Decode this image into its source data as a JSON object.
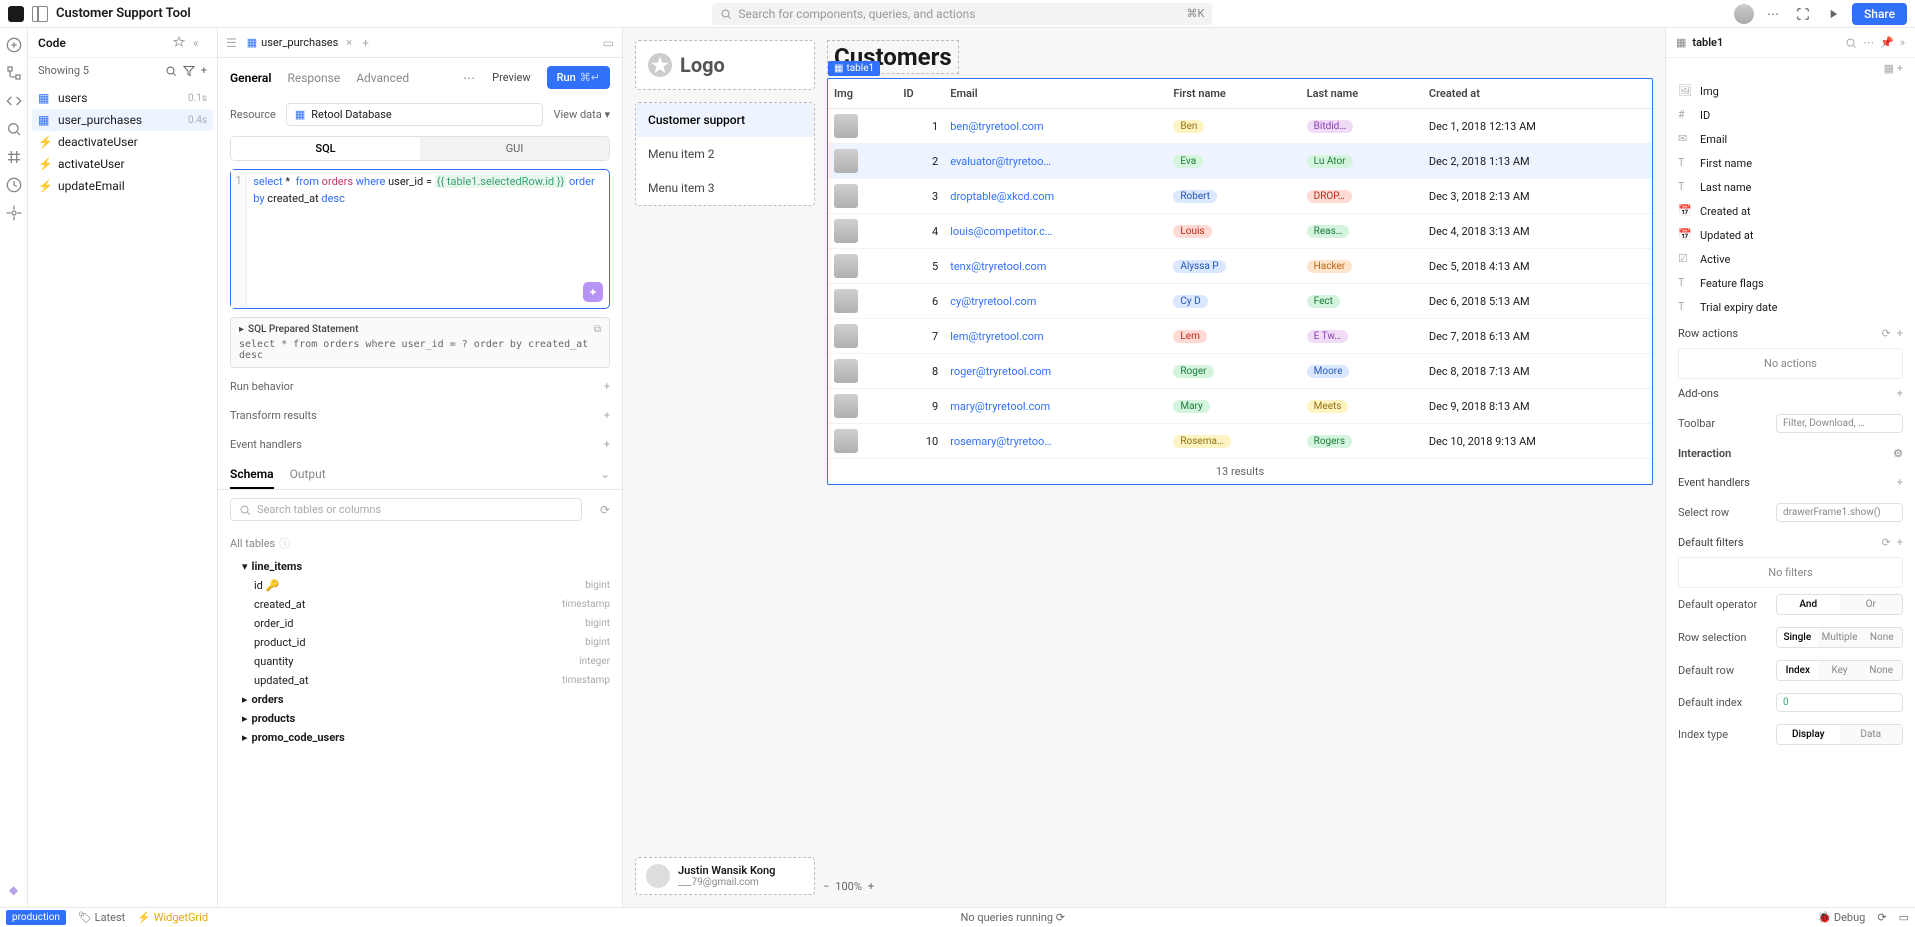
{
  "app_title": "Customer Support Tool",
  "search_placeholder": "Search for components, queries, and actions",
  "search_kbd": "⌘K",
  "share_label": "Share",
  "code_panel": {
    "title": "Code",
    "showing": "Showing 5",
    "items": [
      {
        "name": "users",
        "time": "0.1s",
        "icon": "db"
      },
      {
        "name": "user_purchases",
        "time": "0.4s",
        "icon": "db",
        "selected": true
      },
      {
        "name": "deactivateUser",
        "icon": "fn"
      },
      {
        "name": "activateUser",
        "icon": "fn"
      },
      {
        "name": "updateEmail",
        "icon": "fn"
      }
    ]
  },
  "editor": {
    "tab_name": "user_purchases",
    "sub_tabs": [
      "General",
      "Response",
      "Advanced"
    ],
    "preview": "Preview",
    "run": "Run",
    "run_kbd": "⌘↵",
    "resource_label": "Resource",
    "resource_value": "Retool Database",
    "view_data": "View data",
    "sql_label": "SQL",
    "gui_label": "GUI",
    "sql_line": "1",
    "prep_title": "SQL Prepared Statement",
    "prep_code": "select *  from orders where user_id = ? order by created_at desc",
    "run_behavior": "Run behavior",
    "transform": "Transform results",
    "handlers": "Event handlers",
    "schema_tab": "Schema",
    "output_tab": "Output",
    "schema_search": "Search tables or columns",
    "all_tables": "All tables",
    "schema": {
      "line_items": {
        "open": true,
        "cols": [
          {
            "n": "id",
            "t": "bigint",
            "pk": true
          },
          {
            "n": "created_at",
            "t": "timestamp"
          },
          {
            "n": "order_id",
            "t": "bigint"
          },
          {
            "n": "product_id",
            "t": "bigint"
          },
          {
            "n": "quantity",
            "t": "integer"
          },
          {
            "n": "updated_at",
            "t": "timestamp"
          }
        ]
      },
      "others": [
        "orders",
        "products",
        "promo_code_users"
      ]
    }
  },
  "canvas": {
    "logo": "Logo",
    "menu": [
      "Customer support",
      "Menu item 2",
      "Menu item 3"
    ],
    "customers_title": "Customers",
    "table_badge": "table1",
    "cols": [
      "Img",
      "ID",
      "Email",
      "First name",
      "Last name",
      "Created at"
    ],
    "rows": [
      {
        "id": 1,
        "email": "ben@tryretool.com",
        "fn": "Ben",
        "fnc": "y",
        "ln": "Bitdid…",
        "lnc": "p",
        "ca": "Dec 1, 2018 12:13 AM"
      },
      {
        "id": 2,
        "email": "evaluator@tryretoo…",
        "fn": "Eva",
        "fnc": "g",
        "ln": "Lu Ator",
        "lnc": "g",
        "ca": "Dec 2, 2018 1:13 AM",
        "sel": true
      },
      {
        "id": 3,
        "email": "droptable@xkcd.com",
        "fn": "Robert",
        "fnc": "b",
        "ln": "DROP…",
        "lnc": "r",
        "ca": "Dec 3, 2018 2:13 AM"
      },
      {
        "id": 4,
        "email": "louis@competitor.c…",
        "fn": "Louis",
        "fnc": "r",
        "ln": "Reas…",
        "lnc": "g",
        "ca": "Dec 4, 2018 3:13 AM"
      },
      {
        "id": 5,
        "email": "tenx@tryretool.com",
        "fn": "Alyssa P",
        "fnc": "b",
        "ln": "Hacker",
        "lnc": "o",
        "ca": "Dec 5, 2018 4:13 AM"
      },
      {
        "id": 6,
        "email": "cy@tryretool.com",
        "fn": "Cy D",
        "fnc": "b",
        "ln": "Fect",
        "lnc": "g",
        "ca": "Dec 6, 2018 5:13 AM"
      },
      {
        "id": 7,
        "email": "lem@tryretool.com",
        "fn": "Lem",
        "fnc": "r",
        "ln": "E Tw…",
        "lnc": "p",
        "ca": "Dec 7, 2018 6:13 AM"
      },
      {
        "id": 8,
        "email": "roger@tryretool.com",
        "fn": "Roger",
        "fnc": "g",
        "ln": "Moore",
        "lnc": "b",
        "ca": "Dec 8, 2018 7:13 AM"
      },
      {
        "id": 9,
        "email": "mary@tryretool.com",
        "fn": "Mary",
        "fnc": "g",
        "ln": "Meets",
        "lnc": "y",
        "ca": "Dec 9, 2018 8:13 AM"
      },
      {
        "id": 10,
        "email": "rosemary@tryretoo…",
        "fn": "Rosema…",
        "fnc": "y",
        "ln": "Rogers",
        "lnc": "g",
        "ca": "Dec 10, 2018 9:13 AM"
      }
    ],
    "results": "13 results",
    "user": {
      "name": "Justin Wansik Kong",
      "email": "___79@gmail.com"
    },
    "zoom": "100%"
  },
  "inspector": {
    "name": "table1",
    "fields": [
      "Img",
      "ID",
      "Email",
      "First name",
      "Last name",
      "Created at",
      "Updated at",
      "Active",
      "Feature flags",
      "Trial expiry date"
    ],
    "field_icons": [
      "image",
      "hash",
      "mail",
      "text",
      "text",
      "calendar",
      "calendar",
      "checkbox",
      "text",
      "text"
    ],
    "row_actions": "Row actions",
    "no_actions": "No actions",
    "addons": "Add-ons",
    "toolbar": "Toolbar",
    "toolbar_val": "Filter, Download, …",
    "interaction": "Interaction",
    "event_handlers": "Event handlers",
    "eh_label": "Select row",
    "eh_val": "drawerFrame1.show()",
    "default_filters": "Default filters",
    "no_filters": "No filters",
    "default_operator": "Default operator",
    "op_and": "And",
    "op_or": "Or",
    "row_selection": "Row selection",
    "rs_single": "Single",
    "rs_multiple": "Multiple",
    "rs_none": "None",
    "default_row": "Default row",
    "dr_index": "Index",
    "dr_key": "Key",
    "dr_none": "None",
    "default_index": "Default index",
    "di_val": "0",
    "index_type": "Index type",
    "it_display": "Display",
    "it_data": "Data"
  },
  "statusbar": {
    "production": "production",
    "latest": "Latest",
    "widget": "WidgetGrid",
    "center": "No queries running",
    "debug": "Debug"
  }
}
